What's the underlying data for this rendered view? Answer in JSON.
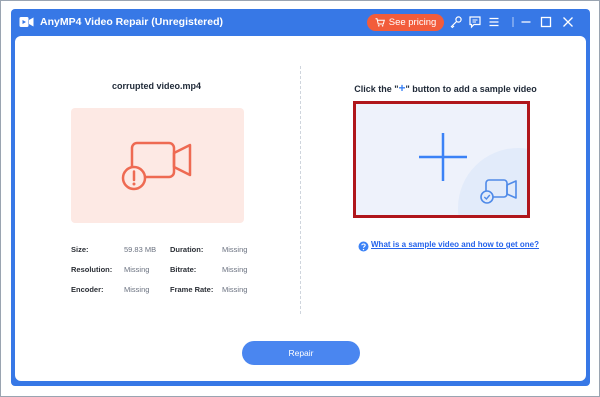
{
  "window": {
    "title": "AnyMP4 Video Repair (Unregistered)",
    "pricing_label": "See pricing"
  },
  "left_panel": {
    "filename": "corrupted video.mp4",
    "meta": [
      {
        "label": "Size:",
        "value": "59.83 MB"
      },
      {
        "label": "Duration:",
        "value": "Missing"
      },
      {
        "label": "Resolution:",
        "value": "Missing"
      },
      {
        "label": "Bitrate:",
        "value": "Missing"
      },
      {
        "label": "Encoder:",
        "value": "Missing"
      },
      {
        "label": "Frame Rate:",
        "value": "Missing"
      }
    ]
  },
  "right_panel": {
    "title_before": "Click the \"",
    "title_plus": "+",
    "title_after": "\" button to add a sample video",
    "help_link": "What is a sample video and how to get one?"
  },
  "repair_label": "Repair",
  "colors": {
    "accent": "#3778e6",
    "pricing": "#f25c3b",
    "corrupt_icon": "#ee6a52",
    "sample_border": "#b0161b",
    "link": "#2563eb"
  }
}
